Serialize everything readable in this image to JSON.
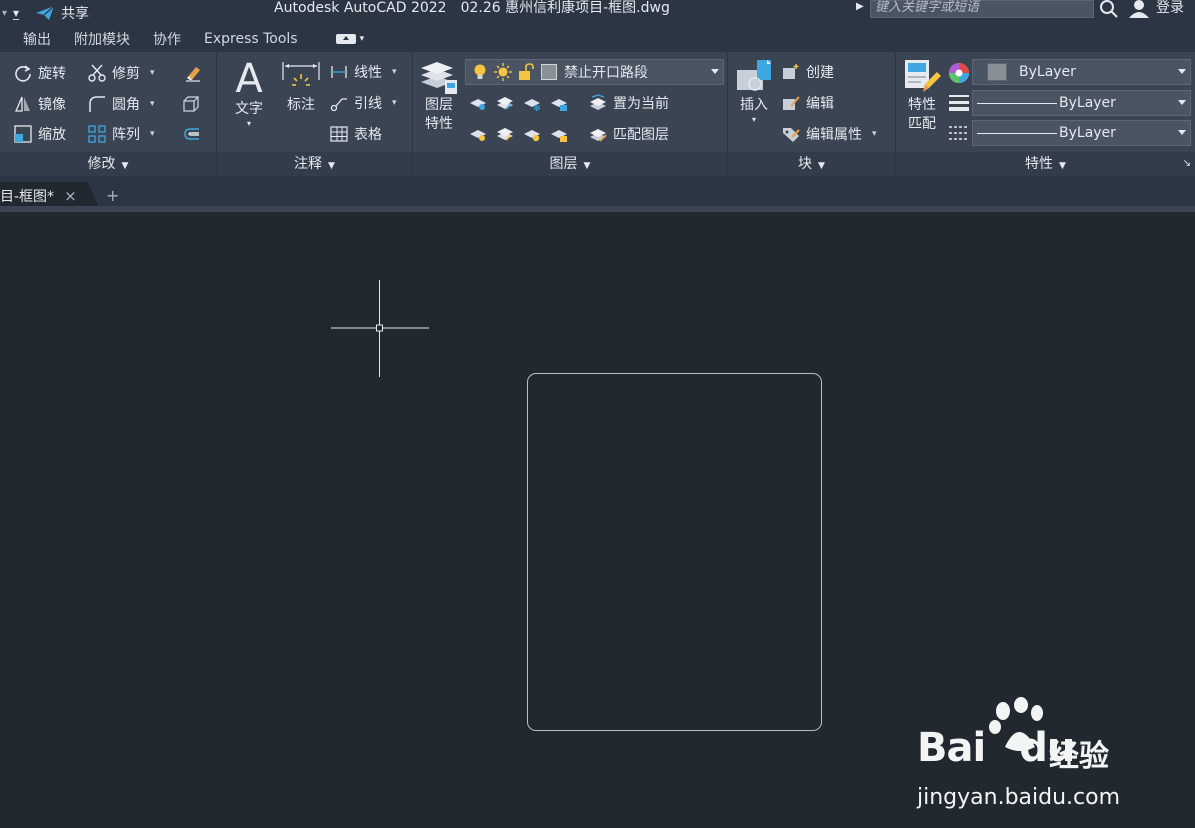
{
  "titlebar": {
    "share_label": "共享",
    "app_name": "Autodesk AutoCAD 2022",
    "document_name": "02.26 惠州信利康项目-框图.dwg",
    "search_placeholder": "键入关键字或短语",
    "login_label": "登录"
  },
  "menu": {
    "items": [
      "输出",
      "附加模块",
      "协作",
      "Express Tools"
    ]
  },
  "ribbon": {
    "modify": {
      "title": "修改",
      "rotate": "旋转",
      "trim": "修剪",
      "mirror": "镜像",
      "fillet": "圆角",
      "scale": "缩放",
      "array": "阵列"
    },
    "annotation": {
      "title": "注释",
      "text": "文字",
      "dimension": "标注",
      "linear": "线性",
      "leader": "引线",
      "table": "表格"
    },
    "layers": {
      "title": "图层",
      "layer_props_line1": "图层",
      "layer_props_line2": "特性",
      "current_layer": "禁止开口路段",
      "set_current": "置为当前",
      "match_layer": "匹配图层"
    },
    "block": {
      "title": "块",
      "insert": "插入",
      "create": "创建",
      "edit": "编辑",
      "edit_attributes": "编辑属性"
    },
    "properties": {
      "title": "特性",
      "match_line1": "特性",
      "match_line2": "匹配",
      "color": "ByLayer",
      "lineweight": "ByLayer",
      "linetype": "ByLayer"
    }
  },
  "doctab": {
    "label": "目-框图*",
    "close": "×",
    "add": "+"
  },
  "watermark": {
    "brand": "Bai",
    "brand2": "du",
    "cn": "经验",
    "url": "jingyan.baidu.com"
  },
  "colors": {
    "canvas": "#212830",
    "ribbon": "#3a4453",
    "titlebar": "#2c3543",
    "accent_blue": "#3fa7e0",
    "bulb_yellow": "#f5c542"
  }
}
